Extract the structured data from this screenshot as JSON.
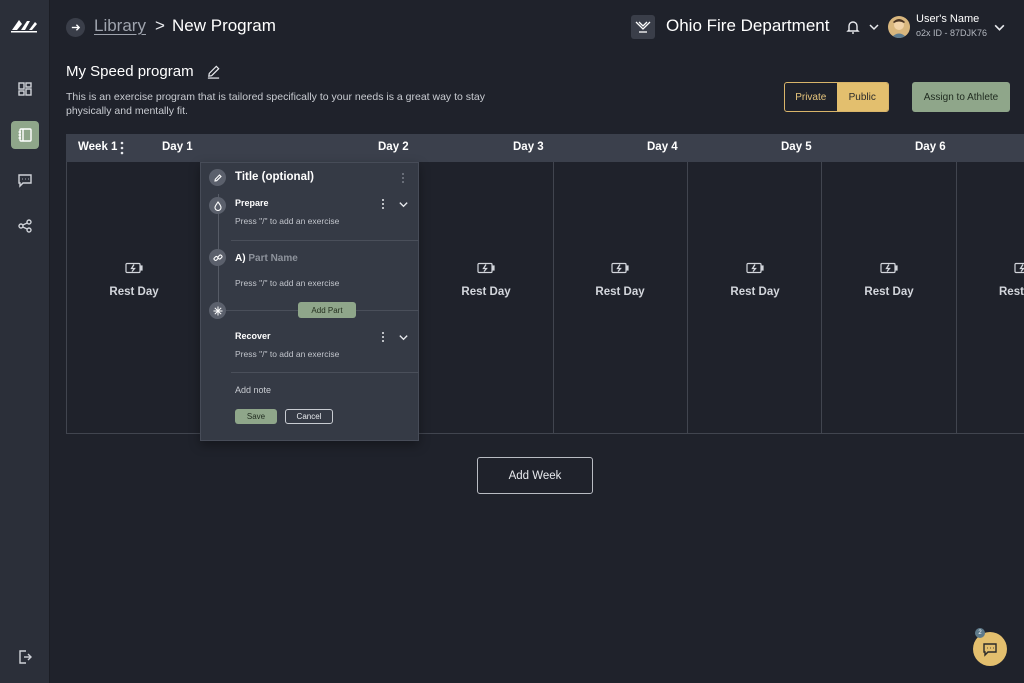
{
  "brand": {
    "logo_text": "O2X"
  },
  "sidebar": {
    "items": [
      {
        "icon": "dashboard-icon"
      },
      {
        "icon": "library-icon",
        "active": true
      },
      {
        "icon": "message-icon"
      },
      {
        "icon": "share-icon"
      }
    ],
    "logout_icon": "logout-icon"
  },
  "header": {
    "breadcrumb_link": "Library",
    "breadcrumb_separator": ">",
    "breadcrumb_current": "New Program",
    "org_name": "Ohio Fire Department",
    "user_name": "User's Name",
    "user_id": "o2x ID - 87DJK76"
  },
  "program": {
    "title": "My Speed program",
    "description": "This is an exercise program that is tailored specifically to your needs is a great way to stay physically and mentally fit.",
    "visibility": {
      "options": [
        "Private",
        "Public"
      ],
      "selected": "Public"
    },
    "assign_label": "Assign to Athlete"
  },
  "week": {
    "label": "Week 1",
    "days": [
      "Day 1",
      "Day 2",
      "Day 3",
      "Day 4",
      "Day 5",
      "Day 6"
    ],
    "rest_label": "Rest Day",
    "last_rest_label": "Rest"
  },
  "editor": {
    "title_placeholder": "Title (optional)",
    "prepare_label": "Prepare",
    "hint": "Press \"/\" to add an exercise",
    "part_prefix": "A)",
    "part_placeholder": "Part Name",
    "add_part_label": "Add Part",
    "recover_label": "Recover",
    "add_note_label": "Add note",
    "save_label": "Save",
    "cancel_label": "Cancel"
  },
  "add_week_label": "Add Week",
  "chat": {
    "badge": "2"
  },
  "colors": {
    "background": "#1f222b",
    "sidebar": "#2b2f39",
    "accent_green": "#8fa68a",
    "accent_gold": "#e3bf6e",
    "panel": "#353a45"
  }
}
